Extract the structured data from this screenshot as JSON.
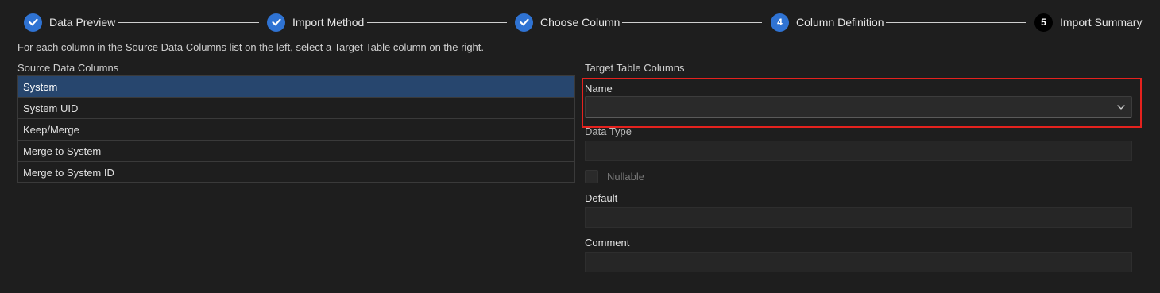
{
  "stepper": {
    "steps": [
      {
        "label": "Data Preview",
        "state": "done",
        "marker": ""
      },
      {
        "label": "Import Method",
        "state": "done",
        "marker": ""
      },
      {
        "label": "Choose Column",
        "state": "done",
        "marker": ""
      },
      {
        "label": "Column Definition",
        "state": "active",
        "marker": "4"
      },
      {
        "label": "Import Summary",
        "state": "pending",
        "marker": "5"
      }
    ]
  },
  "instructions": "For each column in the Source Data Columns list on the left, select a Target Table column on the right.",
  "source": {
    "title": "Source Data Columns",
    "rows": [
      "System",
      "System UID",
      "Keep/Merge",
      "Merge to System",
      "Merge to System ID"
    ],
    "selected_row": "System"
  },
  "target": {
    "title": "Target Table Columns",
    "name_label": "Name",
    "name_value": "",
    "data_type_label": "Data Type",
    "nullable_label": "Nullable",
    "default_label": "Default",
    "comment_label": "Comment"
  },
  "colors": {
    "accent": "#2f73d3",
    "selection": "#27466e",
    "highlight": "#e5221e"
  }
}
